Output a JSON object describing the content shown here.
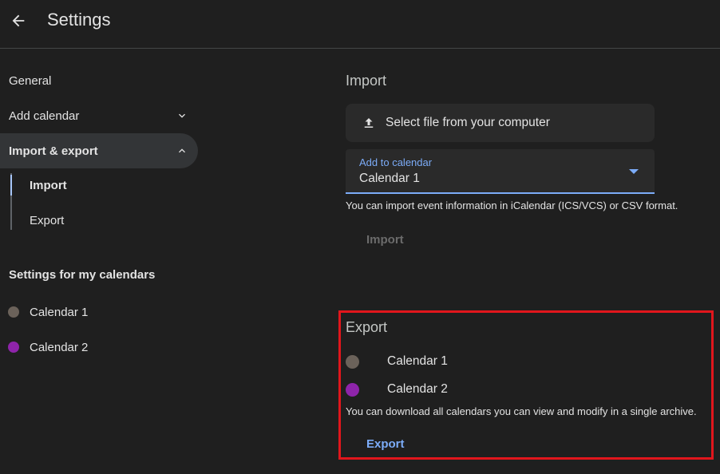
{
  "header": {
    "title": "Settings"
  },
  "sidebar": {
    "items": [
      {
        "label": "General"
      },
      {
        "label": "Add calendar"
      },
      {
        "label": "Import & export"
      }
    ],
    "sub_items": [
      {
        "label": "Import"
      },
      {
        "label": "Export"
      }
    ],
    "section_label": "Settings for my calendars",
    "calendars": [
      {
        "label": "Calendar 1",
        "color": "#6b625a"
      },
      {
        "label": "Calendar 2",
        "color": "#8e24aa"
      }
    ]
  },
  "import": {
    "heading": "Import",
    "file_button": "Select file from your computer",
    "select_label": "Add to calendar",
    "select_value": "Calendar 1",
    "helper": "You can import event information in iCalendar (ICS/VCS) or CSV format.",
    "button": "Import"
  },
  "export": {
    "heading": "Export",
    "calendars": [
      {
        "label": "Calendar 1",
        "color": "#6b625a"
      },
      {
        "label": "Calendar 2",
        "color": "#8e24aa"
      }
    ],
    "helper": "You can download all calendars you can view and modify in a single archive.",
    "button": "Export"
  },
  "colors": {
    "accent": "#7cacf8",
    "highlight": "#e1161c",
    "background": "#1f1f1f"
  }
}
